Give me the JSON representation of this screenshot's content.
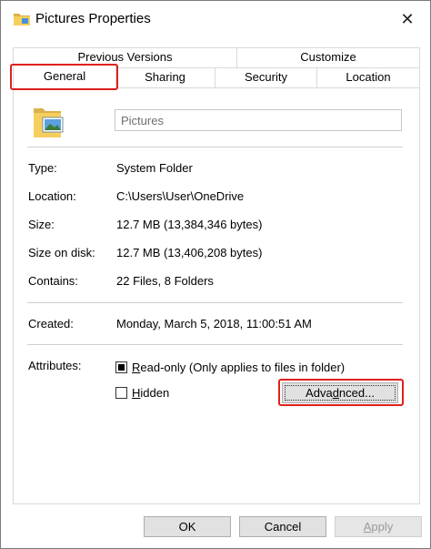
{
  "window": {
    "title": "Pictures Properties",
    "close_glyph": "✕"
  },
  "tabs": {
    "row1": [
      {
        "label": "Previous Versions"
      },
      {
        "label": "Customize"
      }
    ],
    "row2": [
      {
        "label": "General"
      },
      {
        "label": "Sharing"
      },
      {
        "label": "Security"
      },
      {
        "label": "Location"
      }
    ],
    "active": "General"
  },
  "general": {
    "name_value": "Pictures",
    "rows": [
      {
        "label": "Type:",
        "value": "System Folder"
      },
      {
        "label": "Location:",
        "value": "C:\\Users\\User\\OneDrive"
      },
      {
        "label": "Size:",
        "value": "12.7 MB (13,384,346 bytes)"
      },
      {
        "label": "Size on disk:",
        "value": "12.7 MB (13,406,208 bytes)"
      },
      {
        "label": "Contains:",
        "value": "22 Files, 8 Folders"
      },
      {
        "label": "Created:",
        "value": "Monday, March 5, 2018, 11:00:51 AM"
      }
    ],
    "attributes": {
      "label": "Attributes:",
      "readonly": {
        "label_accel": "R",
        "label_rest": "ead-only (Only applies to files in folder)",
        "checked": true
      },
      "hidden": {
        "label_accel": "H",
        "label_rest": "idden",
        "checked": false
      },
      "advanced_button": {
        "accel": "d",
        "pre": "Adva",
        "post": "nced..."
      }
    }
  },
  "footer": {
    "ok": "OK",
    "cancel": "Cancel",
    "apply": {
      "accel": "A",
      "rest": "pply",
      "disabled": true
    }
  },
  "colors": {
    "highlight": "#e0201c",
    "folder": "#f2c94c"
  }
}
